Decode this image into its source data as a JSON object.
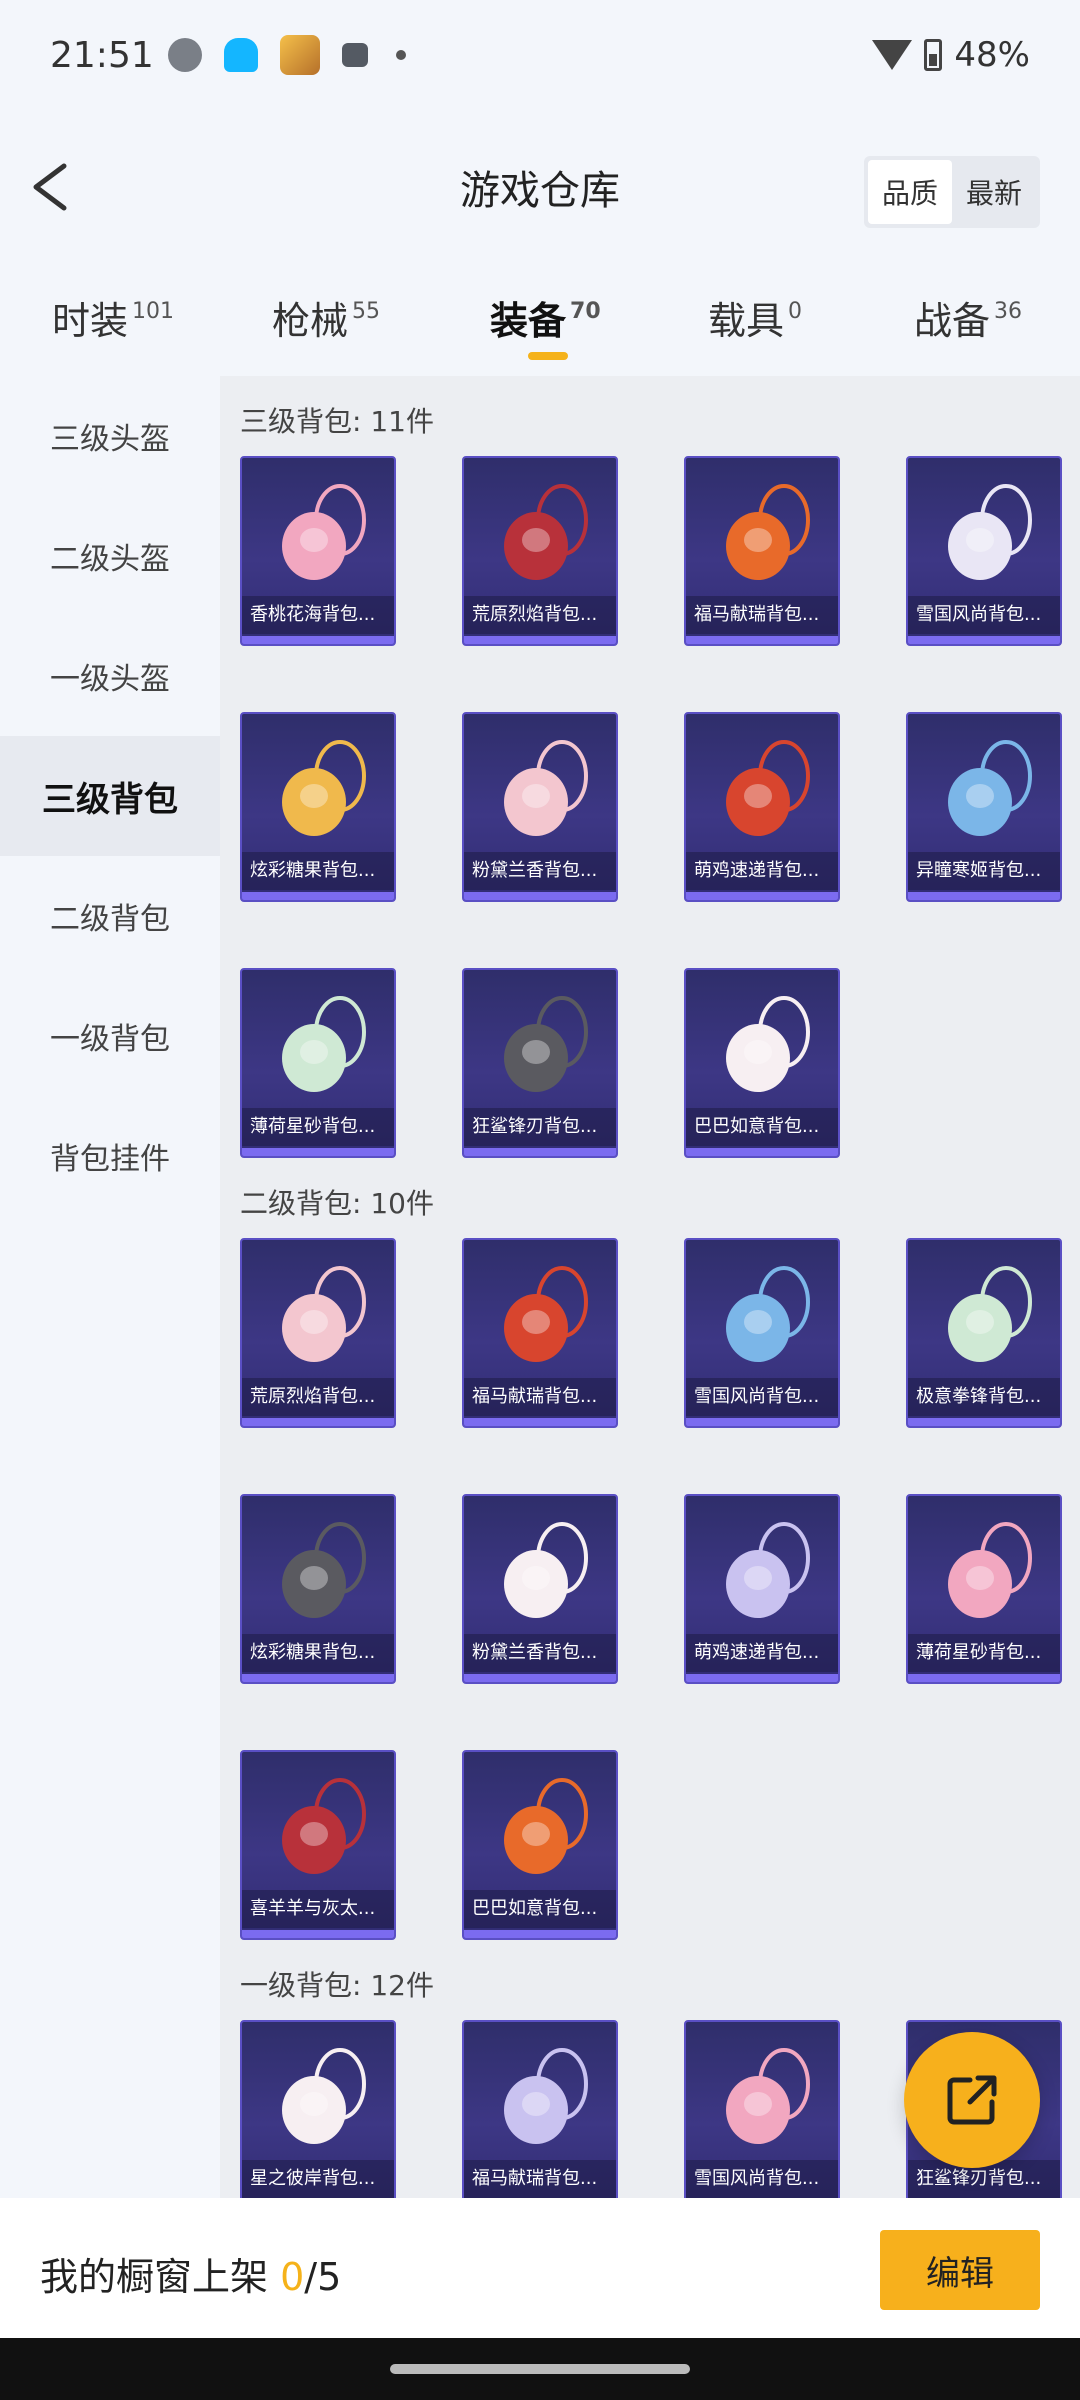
{
  "status": {
    "time": "21:51",
    "battery": "48%",
    "icons": [
      "wechat-icon",
      "qq-icon",
      "game-icon",
      "mail-icon",
      "dot-icon",
      "wifi-icon",
      "battery-icon"
    ]
  },
  "header": {
    "title": "游戏仓库",
    "sort_options": [
      "品质",
      "最新"
    ]
  },
  "tabs": [
    {
      "label": "时装",
      "count": "101"
    },
    {
      "label": "枪械",
      "count": "55"
    },
    {
      "label": "装备",
      "count": "70"
    },
    {
      "label": "载具",
      "count": "0"
    },
    {
      "label": "战备",
      "count": "36"
    }
  ],
  "sidebar": {
    "items": [
      "三级头盔",
      "二级头盔",
      "一级头盔",
      "三级背包",
      "二级背包",
      "一级背包",
      "背包挂件"
    ]
  },
  "sections": [
    {
      "title": "三级背包: 11件",
      "items": [
        "香桃花海背包...",
        "荒原烈焰背包...",
        "福马献瑞背包...",
        "雪国风尚背包...",
        "炫彩糖果背包...",
        "粉黛兰香背包...",
        "萌鸡速递背包...",
        "异瞳寒姬背包...",
        "薄荷星砂背包...",
        "狂鲨锋刃背包...",
        "巴巴如意背包..."
      ]
    },
    {
      "title": "二级背包: 10件",
      "items": [
        "荒原烈焰背包...",
        "福马献瑞背包...",
        "雪国风尚背包...",
        "极意拳锋背包...",
        "炫彩糖果背包...",
        "粉黛兰香背包...",
        "萌鸡速递背包...",
        "薄荷星砂背包...",
        "喜羊羊与灰太...",
        "巴巴如意背包..."
      ]
    },
    {
      "title": "一级背包: 12件",
      "items": [
        "星之彼岸背包...",
        "福马献瑞背包...",
        "雪国风尚背包...",
        "狂鲨锋刃背包..."
      ]
    }
  ],
  "footer": {
    "label": "我的橱窗上架 ",
    "current": "0",
    "total": "/5",
    "edit": "编辑"
  },
  "colors": {
    "accent": "#f7b01c",
    "card_bg": "#3d3785",
    "card_border": "#5a4fc4"
  }
}
